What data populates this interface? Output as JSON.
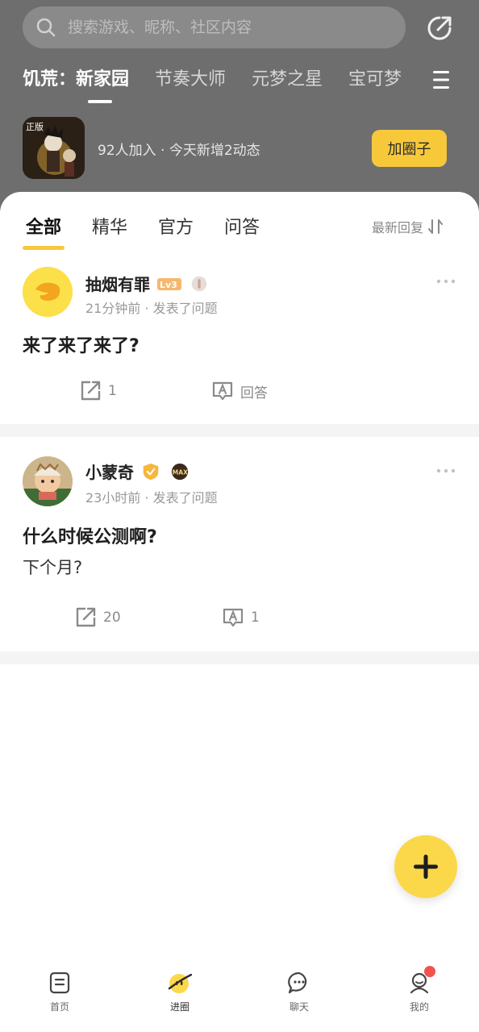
{
  "search": {
    "placeholder": "搜索游戏、昵称、社区内容"
  },
  "circles": {
    "tabs": [
      {
        "label": "饥荒：新家园",
        "active": true
      },
      {
        "label": "节奏大师"
      },
      {
        "label": "元梦之星"
      },
      {
        "label": "宝可梦"
      }
    ]
  },
  "game": {
    "icon_text": "正版",
    "info": "92人加入 · 今天新增2动态",
    "join_label": "加圈子"
  },
  "feed": {
    "tabs": [
      {
        "label": "全部",
        "active": true
      },
      {
        "label": "精华"
      },
      {
        "label": "官方"
      },
      {
        "label": "问答"
      }
    ],
    "sort_label": "最新回复"
  },
  "posts": [
    {
      "username": "抽烟有罪",
      "level_badge": "Lv3",
      "meta": "21分钟前 · 发表了问题",
      "title": "来了来了来了?",
      "body": "",
      "share_count": "1",
      "answer_label": "回答"
    },
    {
      "username": "小蒙奇",
      "level_badge": "MAX",
      "meta": "23小时前 · 发表了问题",
      "title": "什么时候公测啊?",
      "body": "下个月?",
      "share_count": "20",
      "answer_label": "1"
    }
  ],
  "bottom_nav": [
    {
      "label": "首页",
      "icon": "home-doc-icon"
    },
    {
      "label": "进圈",
      "icon": "circle-smile-icon",
      "active": true
    },
    {
      "label": "聊天",
      "icon": "chat-bubble-icon"
    },
    {
      "label": "我的",
      "icon": "profile-icon",
      "notification_dot": true
    }
  ],
  "colors": {
    "accent": "#f7c93a",
    "header_bg": "#6e6e6e",
    "notification": "#f2524e"
  }
}
